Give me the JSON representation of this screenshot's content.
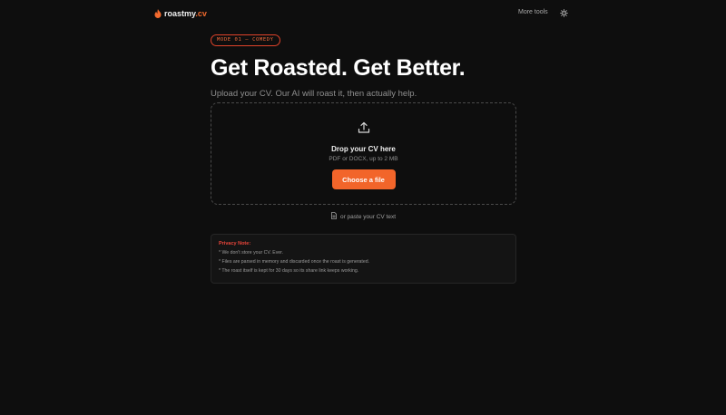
{
  "header": {
    "logo_prefix": "roastmy",
    "logo_suffix": ".cv",
    "more_tools": "More tools"
  },
  "hero": {
    "badge": "MODE 01 — COMEDY",
    "title": "Get Roasted. Get Better.",
    "subtitle": "Upload your CV. Our AI will roast it, then actually help."
  },
  "upload": {
    "title": "Drop your CV here",
    "subtitle": "PDF or DOCX, up to 2 MB",
    "button": "Choose a file",
    "paste_link": "or paste your CV text"
  },
  "privacy": {
    "title": "Privacy Note:",
    "lines": [
      "* We don't store your CV. Ever.",
      "* Files are parsed in memory and discarded once the roast is generated.",
      "* The roast itself is kept for 30 days so its share link keeps working."
    ]
  },
  "colors": {
    "background": "#0e0e0e",
    "accent": "#f2652a",
    "badge_border": "#e0432a",
    "privacy_title": "#e8453a"
  },
  "icons": {
    "logo": "flame-icon",
    "theme": "sun-icon",
    "upload": "upload-icon",
    "paste": "document-icon"
  }
}
